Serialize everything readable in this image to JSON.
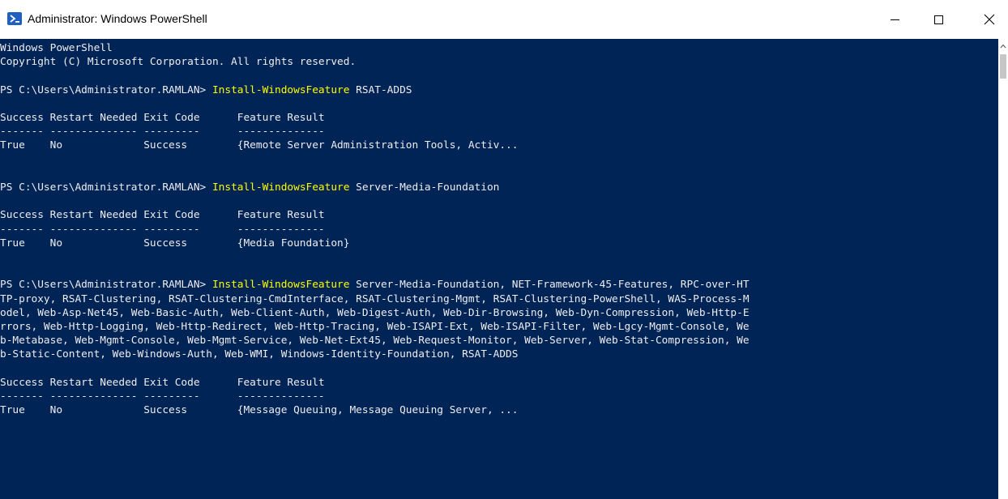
{
  "window": {
    "title": "Administrator: Windows PowerShell"
  },
  "colors": {
    "background": "#012456",
    "text": "#eeedf0",
    "command": "#ffff00"
  },
  "icons": {
    "app": "powershell-icon",
    "minimize": "minimize-icon",
    "maximize": "maximize-icon",
    "close": "close-icon"
  },
  "console": {
    "header1": "Windows PowerShell",
    "header2": "Copyright (C) Microsoft Corporation. All rights reserved.",
    "prompt": "PS C:\\Users\\Administrator.RAMLAN> ",
    "cmdlet": "Install-WindowsFeature",
    "col_headers": "Success Restart Needed Exit Code      Feature Result",
    "col_rule": "------- -------------- ---------      --------------",
    "blocks": [
      {
        "args_first": " RSAT-ADDS",
        "args_rest": "",
        "row": "True    No             Success        {Remote Server Administration Tools, Activ..."
      },
      {
        "args_first": " Server-Media-Foundation",
        "args_rest": "",
        "row": "True    No             Success        {Media Foundation}"
      },
      {
        "args_first": " Server-Media-Foundation, NET-Framework-45-Features, RPC-over-HT",
        "args_rest": "TP-proxy, RSAT-Clustering, RSAT-Clustering-CmdInterface, RSAT-Clustering-Mgmt, RSAT-Clustering-PowerShell, WAS-Process-M\nodel, Web-Asp-Net45, Web-Basic-Auth, Web-Client-Auth, Web-Digest-Auth, Web-Dir-Browsing, Web-Dyn-Compression, Web-Http-E\nrrors, Web-Http-Logging, Web-Http-Redirect, Web-Http-Tracing, Web-ISAPI-Ext, Web-ISAPI-Filter, Web-Lgcy-Mgmt-Console, We\nb-Metabase, Web-Mgmt-Console, Web-Mgmt-Service, Web-Net-Ext45, Web-Request-Monitor, Web-Server, Web-Stat-Compression, We\nb-Static-Content, Web-Windows-Auth, Web-WMI, Windows-Identity-Foundation, RSAT-ADDS",
        "row": "True    No             Success        {Message Queuing, Message Queuing Server, ..."
      }
    ]
  }
}
